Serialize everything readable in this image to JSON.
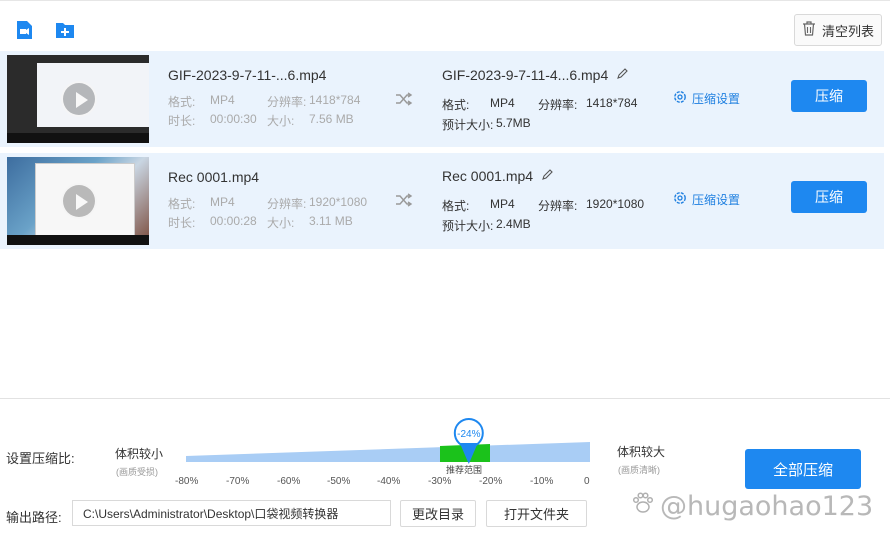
{
  "toolbar": {
    "add_video_icon": "video-add-icon",
    "add_folder_icon": "folder-add-icon",
    "clear_list_label": "清空列表"
  },
  "items": [
    {
      "src_name": "GIF-2023-9-7-11-...6.mp4",
      "format_label": "格式:",
      "format": "MP4",
      "resolution_label": "分辨率:",
      "resolution": "1418*784",
      "duration_label": "时长:",
      "duration": "00:00:30",
      "size_label": "大小:",
      "size": "7.56 MB",
      "dst_name": "GIF-2023-9-7-11-4...6.mp4",
      "dst_format": "MP4",
      "dst_resolution": "1418*784",
      "est_size_label": "预计大小:",
      "est_size": "5.7MB",
      "settings_label": "压缩设置",
      "compress_label": "压缩"
    },
    {
      "src_name": "Rec 0001.mp4",
      "format_label": "格式:",
      "format": "MP4",
      "resolution_label": "分辨率:",
      "resolution": "1920*1080",
      "duration_label": "时长:",
      "duration": "00:00:28",
      "size_label": "大小:",
      "size": "3.11 MB",
      "dst_name": "Rec 0001.mp4",
      "dst_format": "MP4",
      "dst_resolution": "1920*1080",
      "est_size_label": "预计大小:",
      "est_size": "2.4MB",
      "settings_label": "压缩设置",
      "compress_label": "压缩"
    }
  ],
  "ratio": {
    "label": "设置压缩比:",
    "small_label": "体积较小",
    "small_note": "(画质受损)",
    "large_label": "体积较大",
    "large_note": "(画质清晰)",
    "value_label": "-24%",
    "value": -24,
    "recommend_label": "推荐范围",
    "ticks": [
      "-80%",
      "-70%",
      "-60%",
      "-50%",
      "-40%",
      "-30%",
      "-20%",
      "-10%",
      "0"
    ]
  },
  "output": {
    "label": "输出路径:",
    "path": "C:\\Users\\Administrator\\Desktop\\口袋视频转换器",
    "change_dir_label": "更改目录",
    "open_folder_label": "打开文件夹"
  },
  "compress_all_label": "全部压缩",
  "watermark": "@hugaohao123",
  "colors": {
    "accent": "#1e88f0",
    "row_bg": "#eaf3fd",
    "slider_light": "#a9cdf5",
    "recommend": "#1bc21b"
  }
}
